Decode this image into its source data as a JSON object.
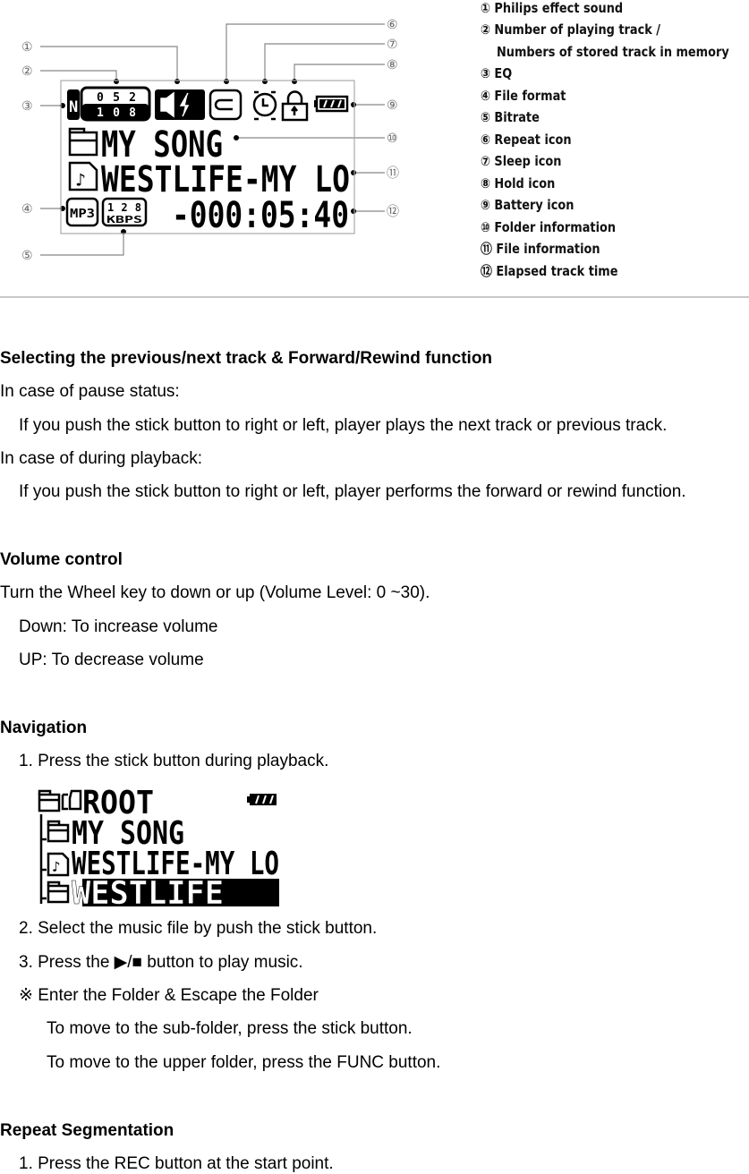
{
  "diagram": {
    "callouts": [
      "①",
      "②",
      "③",
      "④",
      "⑤",
      "⑥",
      "⑦",
      "⑧",
      "⑨",
      "⑩",
      "⑪",
      "⑫"
    ],
    "lcd": {
      "track_current": "052",
      "track_total": "108",
      "eq_letter": "N",
      "folder_name": "MY SONG",
      "file_name": "WESTLIFE-MY LO",
      "format": "MP3",
      "bitrate_value": "128",
      "bitrate_unit": "KBPS",
      "elapsed": "-000:05:40"
    },
    "legend": [
      {
        "num": "①",
        "label": "Philips effect sound"
      },
      {
        "num": "②",
        "label": "Number of playing track /",
        "cont": "Numbers of stored track in memory"
      },
      {
        "num": "③",
        "label": "EQ"
      },
      {
        "num": "④",
        "label": "File format"
      },
      {
        "num": "⑤",
        "label": "Bitrate"
      },
      {
        "num": "⑥",
        "label": "Repeat icon"
      },
      {
        "num": "⑦",
        "label": "Sleep icon"
      },
      {
        "num": "⑧",
        "label": "Hold icon"
      },
      {
        "num": "⑨",
        "label": "Battery icon"
      },
      {
        "num": "⑩",
        "label": "Folder information"
      },
      {
        "num": "⑪",
        "label": "File information"
      },
      {
        "num": "⑫",
        "label": "Elapsed  track time"
      }
    ]
  },
  "sections": {
    "track": {
      "heading": "Selecting the previous/next track & Forward/Rewind function",
      "l1": "In case of pause status:",
      "l2": "If you push the stick button to right or left, player plays the next track or previous track.",
      "l3": "In case of during playback:",
      "l4": "If you push the stick button to right or left, player performs the forward or rewind function."
    },
    "volume": {
      "heading": "Volume control",
      "l1": "Turn the Wheel key to down or up (Volume Level: 0 ~30).",
      "l2": "Down: To increase volume",
      "l3": "UP: To decrease volume"
    },
    "navigation": {
      "heading": "Navigation",
      "l1": "1. Press the stick button during playback.",
      "screen": {
        "root": "ROOT",
        "rows": [
          "MY SONG",
          "WESTLIFE-MY LO",
          "WESTLIFE"
        ]
      },
      "l2": "2. Select the music file by push the stick button.",
      "l3": "3. Press the  ▶/■  button to play music.",
      "l4": "※  Enter the Folder & Escape the Folder",
      "l5": "To move to the sub-folder, press the stick button.",
      "l6": "To move to the upper folder, press the FUNC button."
    },
    "repeat": {
      "heading": "Repeat Segmentation",
      "l1": "1.   Press the REC button at the start point."
    }
  }
}
